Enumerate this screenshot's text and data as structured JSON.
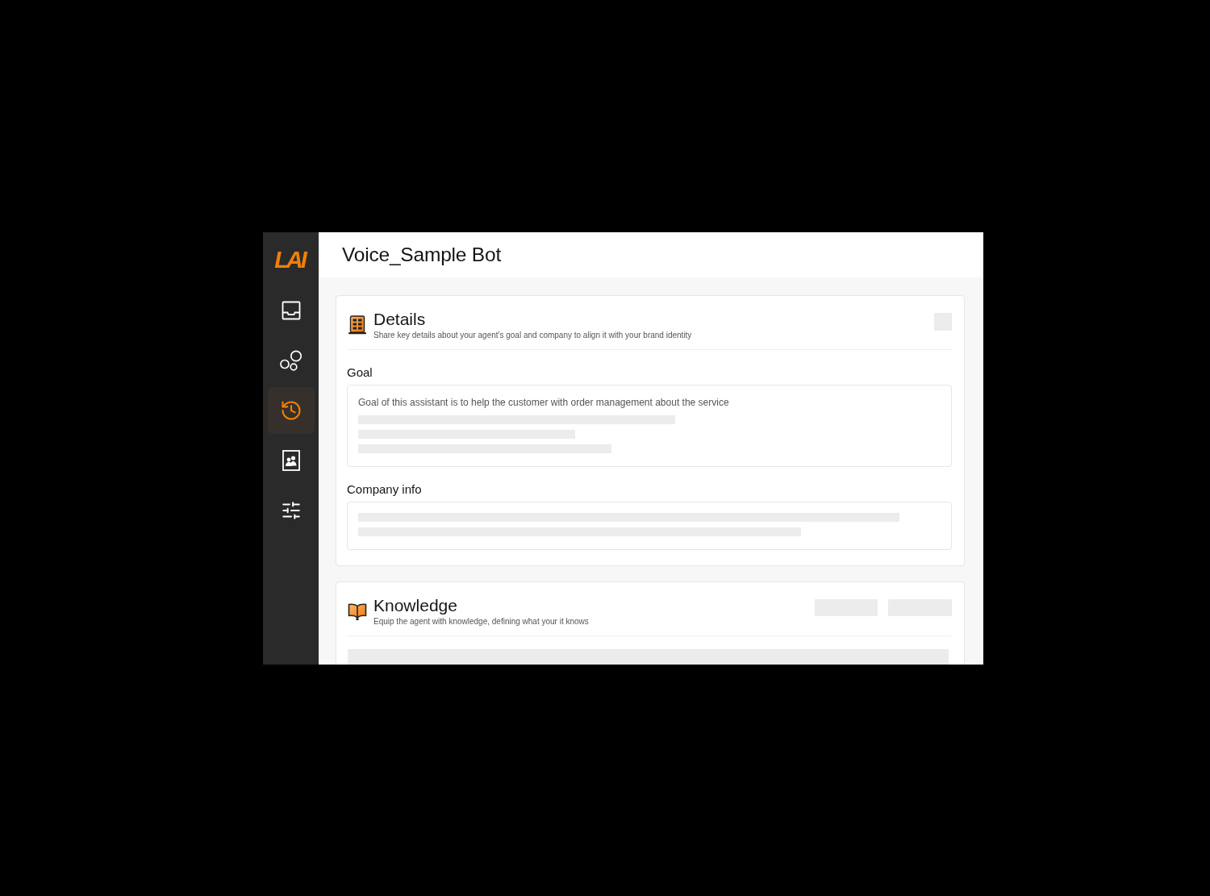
{
  "sidebar": {
    "logo": "LAI",
    "items": [
      {
        "kind": "inbox",
        "selected": false
      },
      {
        "kind": "bubbles",
        "selected": false
      },
      {
        "kind": "history",
        "selected": true
      },
      {
        "kind": "contacts",
        "selected": false
      },
      {
        "kind": "sliders",
        "selected": false
      }
    ]
  },
  "header": {
    "title": "Voice_Sample Bot"
  },
  "sections": [
    {
      "kind": "details",
      "title": "Details",
      "subtitle": "Share key details about your agent's goal and company to align it with your brand identity",
      "fields": [
        {
          "label": "Goal",
          "value": "Goal of this assistant is to help the customer with order management about the service"
        },
        {
          "label": "Company info"
        }
      ]
    },
    {
      "kind": "knowledge",
      "title": "Knowledge",
      "subtitle": "Equip the agent with knowledge, defining what your it knows"
    }
  ]
}
